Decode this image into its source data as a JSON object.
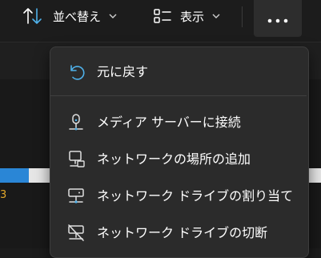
{
  "toolbar": {
    "sort_label": "並べ替え",
    "view_label": "表示",
    "sort_icon": "sort-arrows-icon",
    "view_icon": "view-list-icon",
    "more_icon": "more-dots-icon"
  },
  "progress": {
    "fill_fraction": 0.09
  },
  "drive_letter_fragment": "3",
  "menu": {
    "items": [
      {
        "label": "元に戻す",
        "icon": "undo-icon"
      },
      {
        "label": "メディア サーバーに接続",
        "icon": "media-server-icon"
      },
      {
        "label": "ネットワークの場所の追加",
        "icon": "network-location-icon"
      },
      {
        "label": "ネットワーク ドライブの割り当て",
        "icon": "map-network-drive-icon"
      },
      {
        "label": "ネットワーク ドライブの切断",
        "icon": "disconnect-network-drive-icon"
      }
    ]
  },
  "colors": {
    "accent": "#2a86d6",
    "undo_icon": "#4fb1ea",
    "menu_bg": "#2b2b2b",
    "window_bg": "#1c1c1c"
  }
}
